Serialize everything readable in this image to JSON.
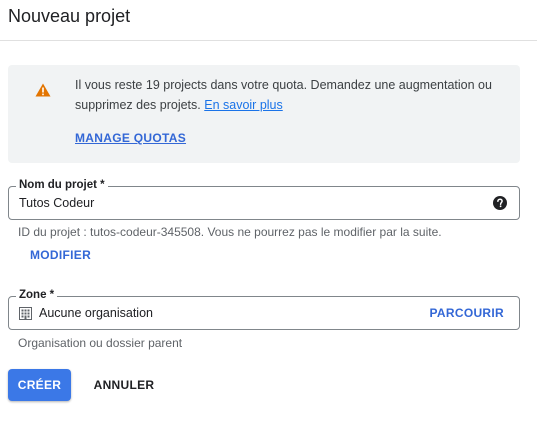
{
  "header": {
    "title": "Nouveau projet"
  },
  "quota_notice": {
    "message": "Il vous reste 19 projects dans votre quota. Demandez une augmentation ou supprimez des projets. ",
    "learn_more": "En savoir plus",
    "manage_quotas": "MANAGE QUOTAS",
    "icon": "warning-icon",
    "icon_color": "#e37400"
  },
  "project_name": {
    "label": "Nom du projet *",
    "value": "Tutos Codeur",
    "help_icon": "help-icon",
    "project_id_hint": "ID du projet : tutos-codeur-345508. Vous ne pourrez pas le modifier par la suite.",
    "modify_label": "MODIFIER"
  },
  "zone": {
    "label": "Zone *",
    "value": "Aucune organisation",
    "icon": "building-icon",
    "browse_label": "PARCOURIR",
    "hint": "Organisation ou dossier parent"
  },
  "actions": {
    "create_label": "CRÉER",
    "cancel_label": "ANNULER",
    "primary_color": "#3b78e7"
  }
}
